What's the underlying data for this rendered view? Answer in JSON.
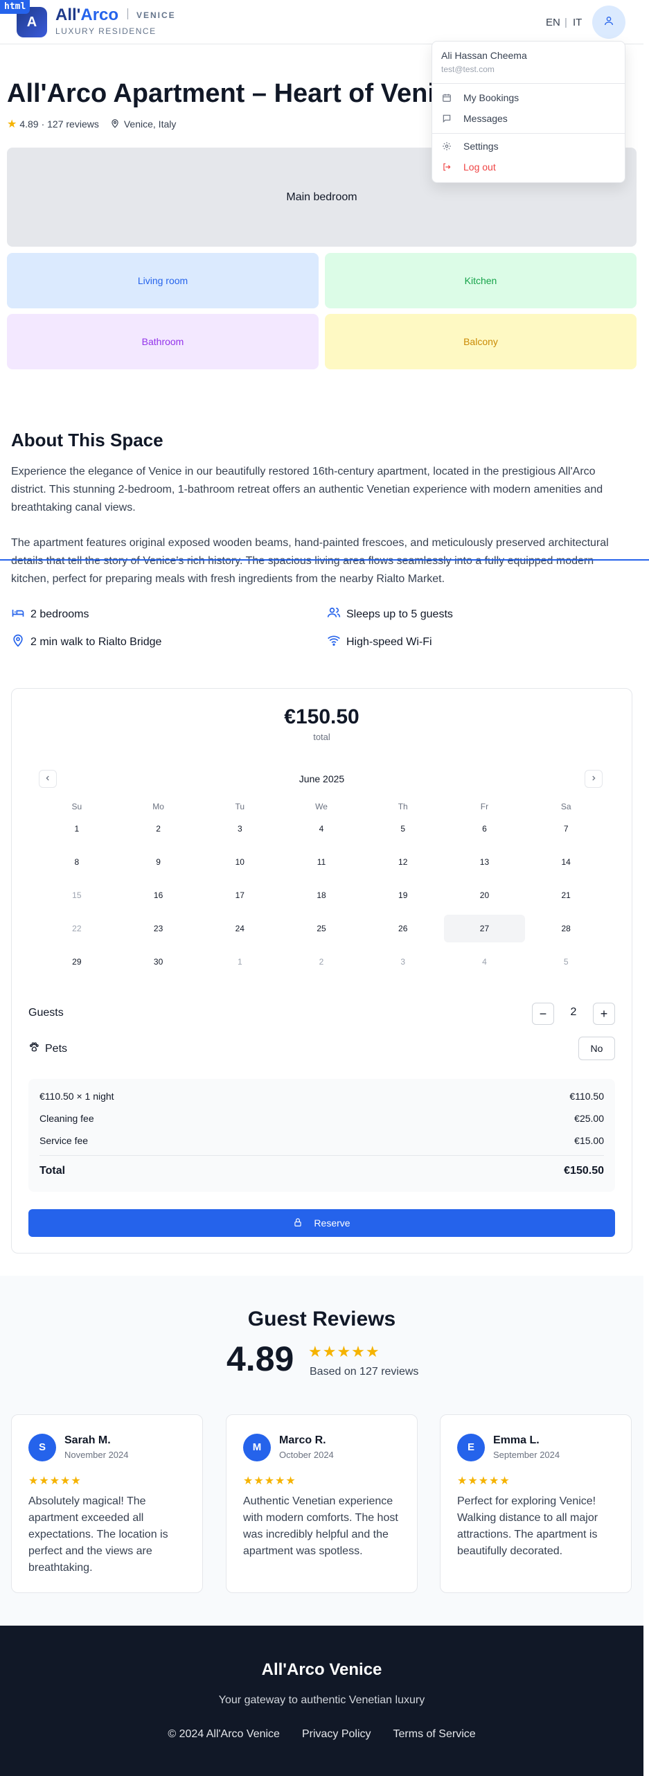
{
  "header": {
    "badge": "html",
    "logo_letter": "A",
    "brand_part1": "All'",
    "brand_part2": "Arco",
    "brand_city": "VENICE",
    "brand_tagline": "LUXURY RESIDENCE",
    "lang_en": "EN",
    "lang_sep": "|",
    "lang_it": "IT"
  },
  "dropdown": {
    "user_name": "Ali Hassan Cheema",
    "user_email": "test@test.com",
    "items": [
      {
        "label": "My Bookings",
        "icon": "calendar-icon"
      },
      {
        "label": "Messages",
        "icon": "message-icon"
      },
      {
        "label": "Settings",
        "icon": "gear-icon"
      },
      {
        "label": "Log out",
        "icon": "logout-icon"
      }
    ]
  },
  "listing": {
    "title": "All'Arco Apartment – Heart of Venice",
    "rating": "4.89",
    "reviews_count": "· 127 reviews",
    "location": "Venice, Italy"
  },
  "gallery": {
    "main": "Main bedroom",
    "living": "Living room",
    "kitchen": "Kitchen",
    "bathroom": "Bathroom",
    "balcony": "Balcony"
  },
  "about": {
    "heading": "About This Space",
    "p1": "Experience the elegance of Venice in our beautifully restored 16th-century apartment, located in the prestigious All'Arco district. This stunning 2-bedroom, 1-bathroom retreat offers an authentic Venetian experience with modern amenities and breathtaking canal views.",
    "p2": "The apartment features original exposed wooden beams, hand-painted frescoes, and meticulously preserved architectural details that tell the story of Venice's rich history. The spacious living area flows seamlessly into a fully equipped modern kitchen, perfect for preparing meals with fresh ingredients from the nearby Rialto Market.",
    "features": [
      {
        "label": "2 bedrooms",
        "icon": "bed-icon"
      },
      {
        "label": "Sleeps up to 5 guests",
        "icon": "users-icon"
      },
      {
        "label": "2 min walk to Rialto Bridge",
        "icon": "map-pin-icon"
      },
      {
        "label": "High-speed Wi-Fi",
        "icon": "wifi-icon"
      }
    ]
  },
  "booking": {
    "price": "€150.50",
    "price_sub": "total",
    "month": "June 2025",
    "weekdays": [
      "Su",
      "Mo",
      "Tu",
      "We",
      "Th",
      "Fr",
      "Sa"
    ],
    "weeks": [
      [
        "1",
        "2",
        "3",
        "4",
        "5",
        "6",
        "7"
      ],
      [
        "8",
        "9",
        "10",
        "11",
        "12",
        "13",
        "14"
      ],
      [
        "15",
        "16",
        "17",
        "18",
        "19",
        "20",
        "21"
      ],
      [
        "22",
        "23",
        "24",
        "25",
        "26",
        "27",
        "28"
      ],
      [
        "29",
        "30",
        "1",
        "2",
        "3",
        "4",
        "5"
      ]
    ],
    "muted_days": [
      "2-0",
      "3-0",
      "4-2",
      "4-3",
      "4-4",
      "4-5",
      "4-6"
    ],
    "selected_day": "3-5",
    "guests_label": "Guests",
    "guests_value": "2",
    "minus": "−",
    "plus": "+",
    "pets_label": "Pets",
    "pets_value": "No",
    "summary": {
      "nightly_label": "€110.50 × 1 night",
      "nightly_value": "€110.50",
      "cleaning_label": "Cleaning fee",
      "cleaning_value": "€25.00",
      "service_label": "Service fee",
      "service_value": "€15.00",
      "total_label": "Total",
      "total_value": "€150.50"
    },
    "reserve_label": "Reserve"
  },
  "reviews": {
    "heading": "Guest Reviews",
    "score": "4.89",
    "stars": "★★★★★",
    "based_on": "Based on 127 reviews",
    "items": [
      {
        "initial": "S",
        "name": "Sarah M.",
        "date": "November 2024",
        "stars": "★★★★★",
        "text": "Absolutely magical! The apartment exceeded all expectations. The location is perfect and the views are breathtaking."
      },
      {
        "initial": "M",
        "name": "Marco R.",
        "date": "October 2024",
        "stars": "★★★★★",
        "text": "Authentic Venetian experience with modern comforts. The host was incredibly helpful and the apartment was spotless."
      },
      {
        "initial": "E",
        "name": "Emma L.",
        "date": "September 2024",
        "stars": "★★★★★",
        "text": "Perfect for exploring Venice! Walking distance to all major attractions. The apartment is beautifully decorated."
      }
    ]
  },
  "footer": {
    "title": "All'Arco Venice",
    "tagline": "Your gateway to authentic Venetian luxury",
    "copyright": "© 2024 All'Arco Venice",
    "privacy": "Privacy Policy",
    "terms": "Terms of Service"
  },
  "colors": {
    "accent": "#2563eb",
    "star": "#f5b301",
    "logout": "#ef4444",
    "footer_bg": "#111827"
  }
}
